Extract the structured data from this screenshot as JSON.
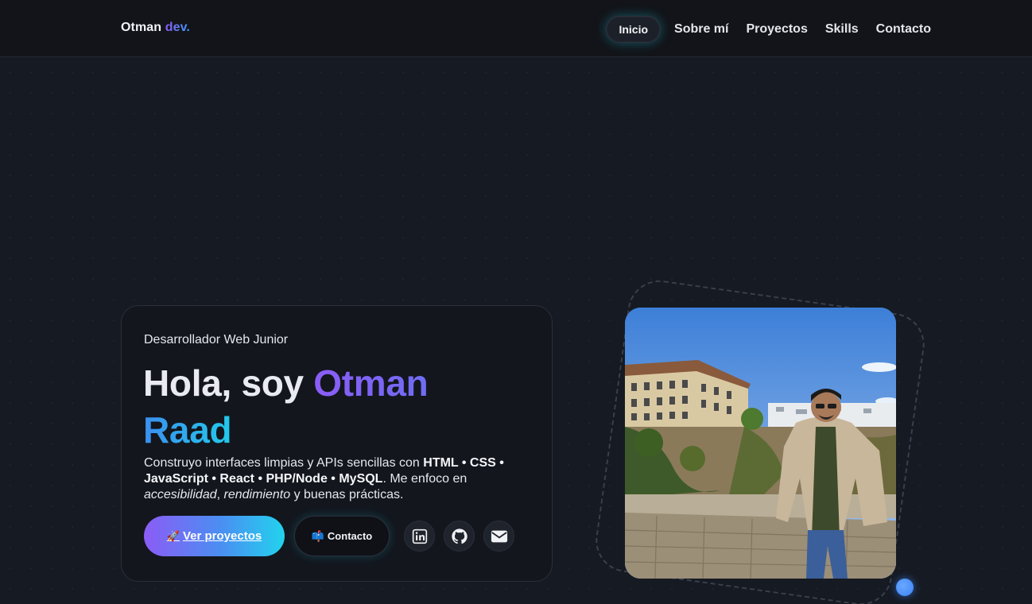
{
  "nav": {
    "brand_name": "Otman",
    "brand_accent": "dev.",
    "links": [
      {
        "label": "Inicio",
        "active": true
      },
      {
        "label": "Sobre mí",
        "active": false
      },
      {
        "label": "Proyectos",
        "active": false
      },
      {
        "label": "Skills",
        "active": false
      },
      {
        "label": "Contacto",
        "active": false
      }
    ]
  },
  "hero": {
    "subtitle": "Desarrollador Web Junior",
    "greeting": "Hola, soy",
    "first_name": "Otman",
    "last_name": "Raad",
    "description": {
      "intro": "Construyo interfaces limpias y APIs sencillas con",
      "stack": "HTML • CSS • JavaScript • React • PHP/Node • MySQL",
      "focus_prefix": ". Me enfoco en",
      "focus_1": "accesibilidad",
      "separator": ",",
      "focus_2": "rendimiento",
      "focus_suffix": "y buenas prácticas."
    },
    "primary_button": {
      "emoji": "🚀",
      "label": "Ver proyectos"
    },
    "secondary_button": {
      "emoji": "📫",
      "label": "Contacto"
    },
    "social": [
      {
        "icon": "linkedin-icon"
      },
      {
        "icon": "github-icon"
      },
      {
        "icon": "mail-icon"
      }
    ]
  },
  "colors": {
    "accent_purple": "#8b5cf6",
    "accent_cyan": "#22d3ee",
    "accent_blue": "#3b82f6",
    "background": "#161a22"
  }
}
